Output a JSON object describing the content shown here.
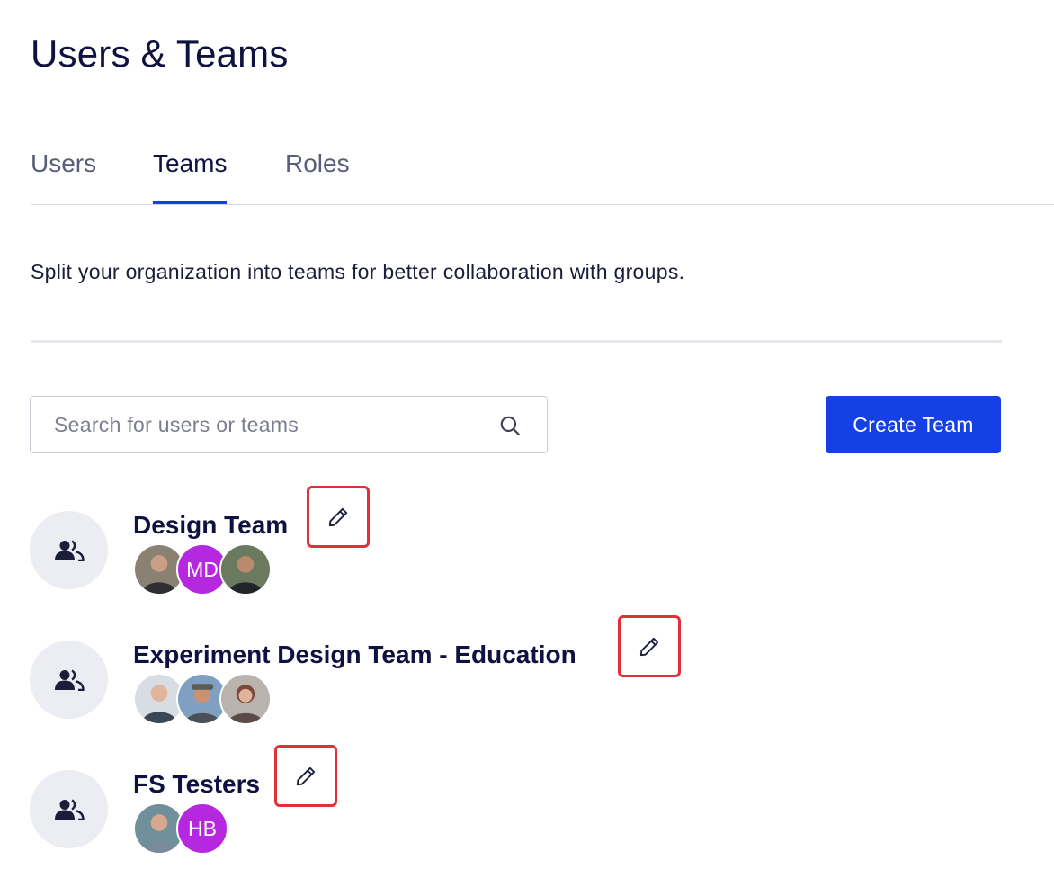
{
  "header": {
    "title": "Users & Teams"
  },
  "tabs": [
    {
      "label": "Users",
      "active": false
    },
    {
      "label": "Teams",
      "active": true
    },
    {
      "label": "Roles",
      "active": false
    }
  ],
  "description": "Split your organization into teams for better collaboration with groups.",
  "search": {
    "placeholder": "Search for users or teams",
    "value": "",
    "icon": "search-icon"
  },
  "create_button": {
    "label": "Create Team"
  },
  "accent_color": "#1540e6",
  "teams": [
    {
      "name": "Design Team",
      "members": [
        {
          "type": "photo",
          "label": ""
        },
        {
          "type": "initials",
          "label": "MD"
        },
        {
          "type": "photo",
          "label": ""
        }
      ]
    },
    {
      "name": "Experiment Design Team - Education",
      "members": [
        {
          "type": "photo",
          "label": ""
        },
        {
          "type": "photo",
          "label": ""
        },
        {
          "type": "photo",
          "label": ""
        }
      ]
    },
    {
      "name": "FS Testers",
      "members": [
        {
          "type": "photo",
          "label": ""
        },
        {
          "type": "initials",
          "label": "HB"
        }
      ]
    }
  ]
}
